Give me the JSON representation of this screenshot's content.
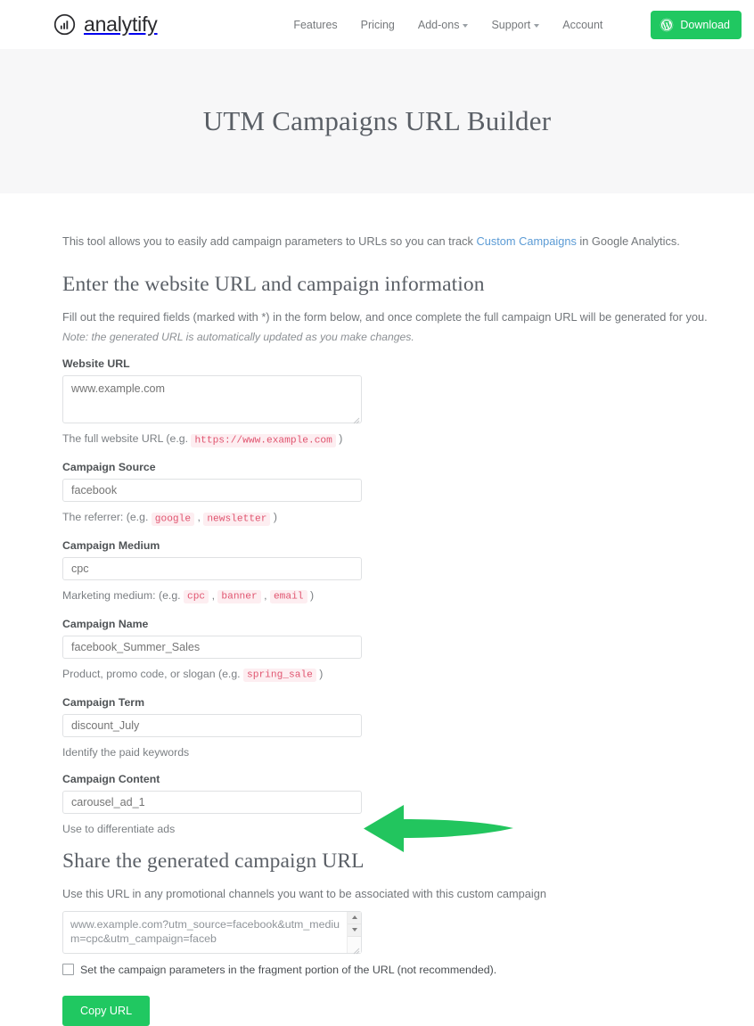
{
  "header": {
    "brand": "analytify",
    "brand_icon": "analytify-circle-bars-logo",
    "nav": [
      {
        "label": "Features",
        "has_caret": false
      },
      {
        "label": "Pricing",
        "has_caret": false
      },
      {
        "label": "Add-ons",
        "has_caret": true
      },
      {
        "label": "Support",
        "has_caret": true
      },
      {
        "label": "Account",
        "has_caret": false
      }
    ],
    "download_label": "Download",
    "download_icon": "wordpress-icon",
    "accent_green": "#20c861"
  },
  "hero": {
    "title": "UTM Campaigns URL Builder",
    "background": "#f7f7f8"
  },
  "intro": {
    "before_link": "This tool allows you to easily add campaign parameters to URLs so you can track ",
    "link": "Custom Campaigns",
    "link_color": "#5b9bd5",
    "after_link": " in Google Analytics."
  },
  "form": {
    "section_title": "Enter the website URL and campaign information",
    "lead": "Fill out the required fields (marked with *) in the form below, and once complete the full campaign URL will be generated for you.",
    "note": "Note: the generated URL is automatically updated as you make changes.",
    "fields": [
      {
        "label": "Website URL",
        "placeholder": "www.example.com",
        "value": "",
        "type": "textarea",
        "helper_prefix": "The full website URL (e.g. ",
        "tokens": [
          "https://www.example.com"
        ],
        "helper_suffix": " )"
      },
      {
        "label": "Campaign Source",
        "placeholder": "facebook",
        "value": "",
        "type": "text",
        "helper_prefix": "The referrer: (e.g. ",
        "tokens": [
          "google",
          "newsletter"
        ],
        "helper_suffix": " )"
      },
      {
        "label": "Campaign Medium",
        "placeholder": "cpc",
        "value": "",
        "type": "text",
        "helper_prefix": "Marketing medium: (e.g. ",
        "tokens": [
          "cpc",
          "banner",
          "email"
        ],
        "helper_suffix": " )"
      },
      {
        "label": "Campaign Name",
        "placeholder": "facebook_Summer_Sales",
        "value": "",
        "type": "text",
        "helper_prefix": "Product, promo code, or slogan (e.g. ",
        "tokens": [
          "spring_sale"
        ],
        "helper_suffix": " )"
      },
      {
        "label": "Campaign Term",
        "placeholder": "discount_July",
        "value": "",
        "type": "text",
        "helper_prefix": "Identify the paid keywords",
        "tokens": [],
        "helper_suffix": ""
      },
      {
        "label": "Campaign Content",
        "placeholder": "carousel_ad_1",
        "value": "",
        "type": "text",
        "helper_prefix": "Use to differentiate ads",
        "tokens": [],
        "helper_suffix": ""
      }
    ]
  },
  "share": {
    "title": "Share the generated campaign URL",
    "description": "Use this URL in any promotional channels you want to be associated with this custom campaign",
    "generated_url": "www.example.com?utm_source=facebook&utm_medium=cpc&utm_campaign=faceb",
    "scrollbar_up_icon": "triangle-up-icon",
    "scrollbar_down_icon": "triangle-down-icon",
    "checkbox_label": "Set the campaign parameters in the fragment portion of the URL (not recommended).",
    "checkbox_checked": false,
    "copy_label": "Copy URL"
  },
  "annotation": {
    "icon": "green-left-arrow-annotation",
    "color": "#22c55e"
  },
  "code_token_style": {
    "color": "#e0546f",
    "background": "#fdeef1"
  }
}
